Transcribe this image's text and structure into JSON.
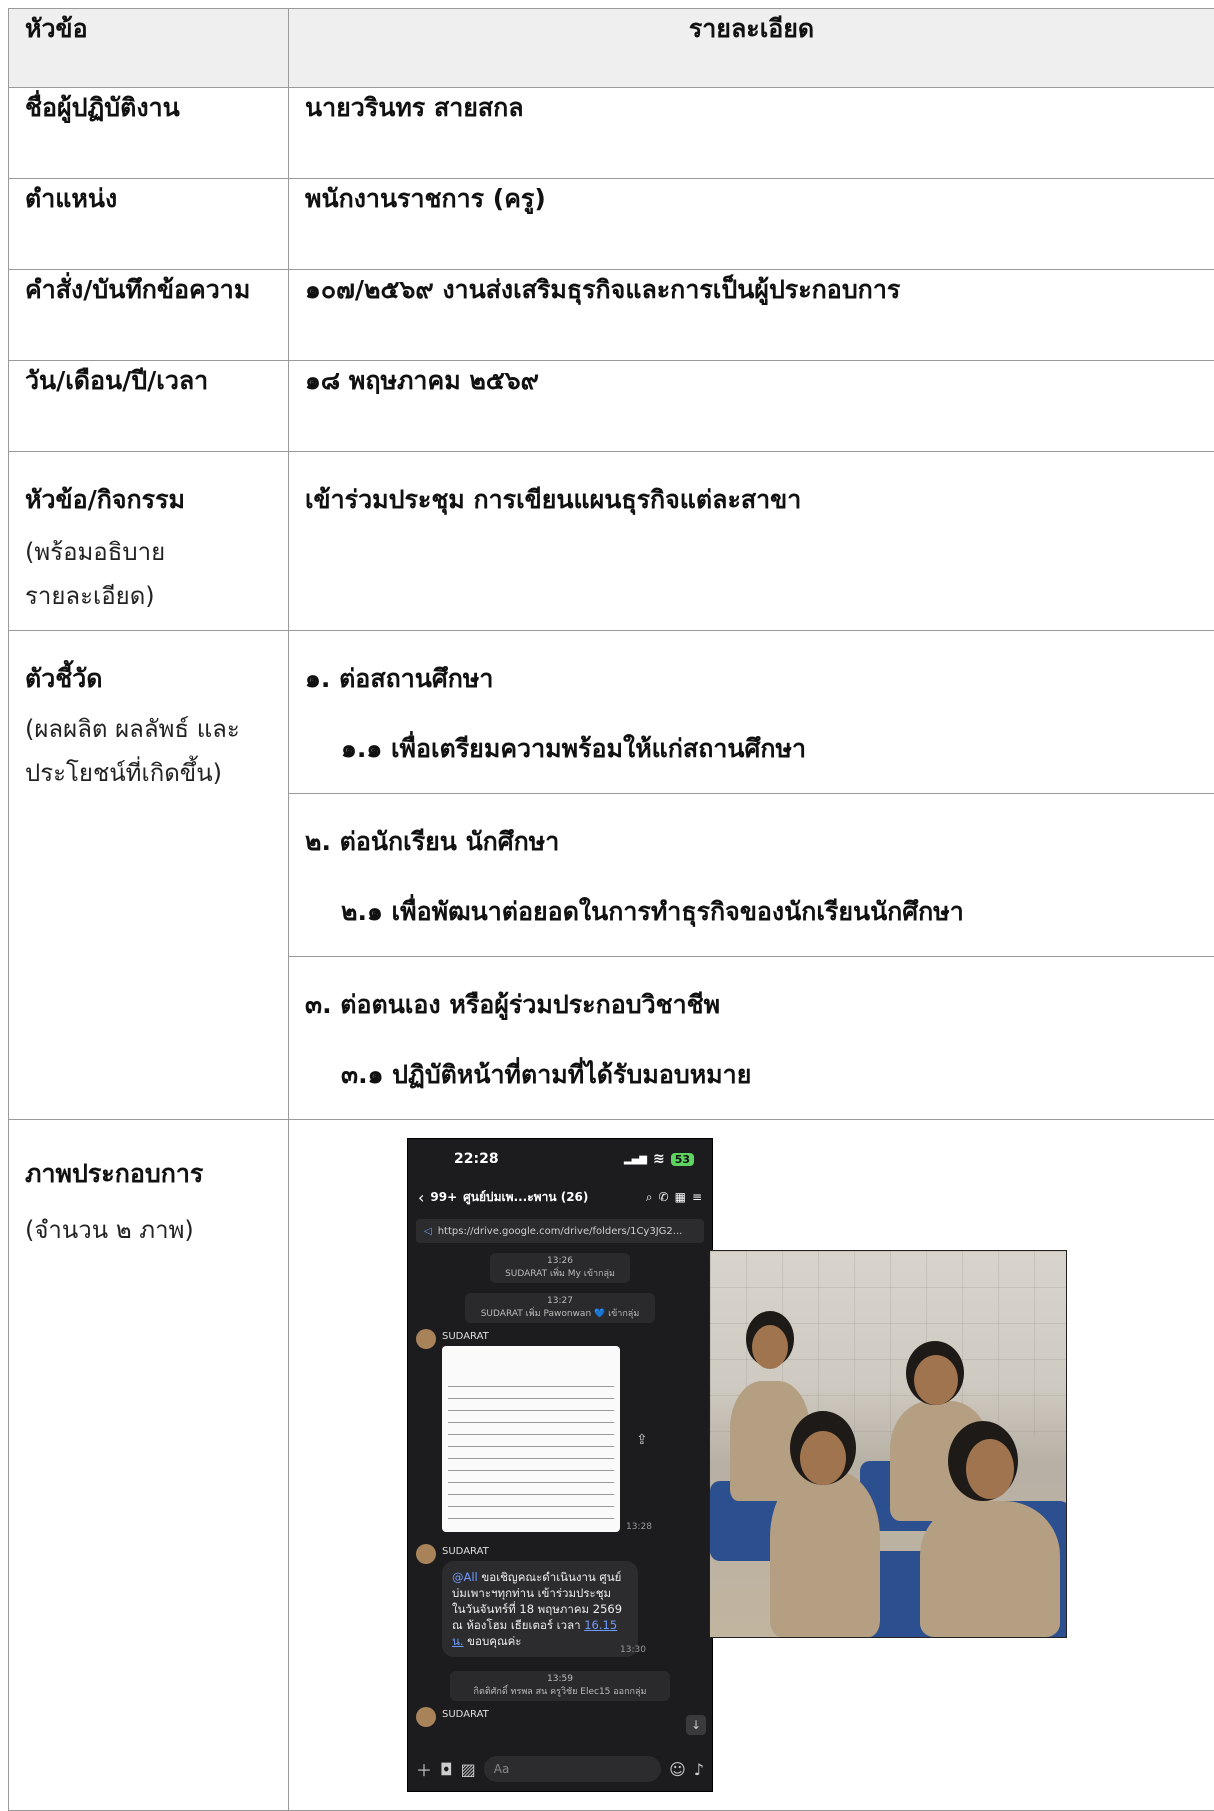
{
  "header": {
    "col_topic": "หัวข้อ",
    "col_detail": "รายละเอียด"
  },
  "rows": {
    "name": {
      "label": "ชื่อผู้ปฏิบัติงาน",
      "value": "นายวรินทร สายสกล"
    },
    "position": {
      "label": "ตำแหน่ง",
      "value": "พนักงานราชการ (ครู)"
    },
    "order": {
      "label": "คำสั่ง/บันทึกข้อความ",
      "value": "๑๐๗/๒๕๖๙ งานส่งเสริมธุรกิจและการเป็นผู้ประกอบการ"
    },
    "date": {
      "label": "วัน/เดือน/ปี/เวลา",
      "value": "๑๘ พฤษภาคม ๒๕๖๙"
    },
    "topic": {
      "label": "หัวข้อ/กิจกรรม",
      "note_line1": "(พร้อมอธิบาย",
      "note_line2": "รายละเอียด)",
      "value": "เข้าร่วมประชุม การเขียนแผนธุรกิจแต่ละสาขา"
    },
    "indicator": {
      "label": "ตัวชี้วัด",
      "note_line1": "(ผลผลิต ผลลัพธ์ และ",
      "note_line2": "ประโยชน์ที่เกิดขึ้น)",
      "items": [
        {
          "head": "๑. ต่อสถานศึกษา",
          "sub": "๑.๑ เพื่อเตรียมความพร้อมให้แก่สถานศึกษา"
        },
        {
          "head": "๒. ต่อนักเรียน นักศึกษา",
          "sub": "๒.๑ เพื่อพัฒนาต่อยอดในการทำธุรกิจของนักเรียนนักศึกษา"
        },
        {
          "head": "๓. ต่อตนเอง หรือผู้ร่วมประกอบวิชาชีพ",
          "sub": "๓.๑ ปฏิบัติหน้าที่ตามที่ได้รับมอบหมาย"
        }
      ]
    },
    "photos": {
      "label": "ภาพประกอบการ",
      "note": "(จำนวน ๒ ภาพ)"
    }
  },
  "phone": {
    "clock": "22:28",
    "battery": "53",
    "back_count": "99+",
    "chat_title": "ศูนย์บ่มเพ...ะพาน (26)",
    "pinned_link": "https://drive.google.com/drive/folders/1Cy3JG2...",
    "sys1_time": "13:26",
    "sys1_text": "SUDARAT เพิ่ม My เข้ากลุ่ม",
    "sys2_time": "13:27",
    "sys2_text": "SUDARAT เพิ่ม Pawonwan 💙 เข้ากลุ่ม",
    "sender": "SUDARAT",
    "doc_time": "13:28",
    "msg_mention": "@All",
    "msg_text": " ขอเชิญคณะดำเนินงาน ศูนย์บ่มเพาะฯทุกท่าน เข้าร่วมประชุม ในวันจันทร์ที่ 18 พฤษภาคม 2569 ณ ห้องโฮม เธียเตอร์ เวลา ",
    "msg_time_link": "16.15 น.",
    "msg_tail": " ขอบคุณค่ะ",
    "msg_time": "13:30",
    "sys3_time": "13:59",
    "sys3_text": "กิตติศักดิ์ ทรพล สน ครูวิชัย Elec15 ออกกลุ่ม",
    "sender2": "SUDARAT",
    "input_placeholder": "Aa"
  }
}
